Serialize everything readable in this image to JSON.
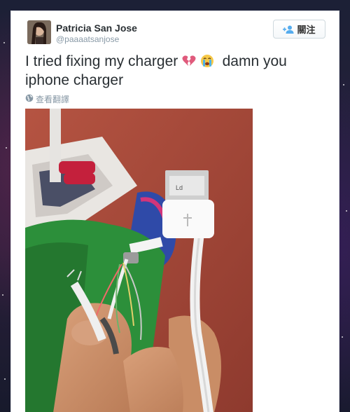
{
  "tweet": {
    "display_name": "Patricia San Jose",
    "handle": "@paaaatsanjose",
    "follow_label": "關注",
    "text_part1": "I tried fixing my charger",
    "text_part2": "damn you iphone charger",
    "translate_label": "查看翻譯",
    "emojis": [
      "broken-heart-icon",
      "crying-face-icon"
    ]
  },
  "photo": {
    "usb_marking": "Ld"
  },
  "colors": {
    "accent": "#55acee",
    "text": "#292f33",
    "muted": "#8899a6"
  }
}
